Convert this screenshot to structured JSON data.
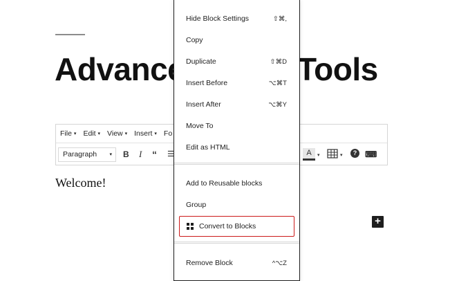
{
  "post": {
    "title_left": "Advance",
    "title_right": "Tools",
    "paragraph": "Welcome!"
  },
  "classic_editor": {
    "menu": [
      {
        "label": "File",
        "caret": "▾"
      },
      {
        "label": "Edit",
        "caret": "▾"
      },
      {
        "label": "View",
        "caret": "▾"
      },
      {
        "label": "Insert",
        "caret": "▾"
      },
      {
        "label": "Fo",
        "caret": ""
      }
    ],
    "format_select": "Paragraph",
    "toolbar": {
      "bold": "B",
      "italic": "I",
      "quote": "“",
      "list": "☰",
      "text_color": "A",
      "help": "?",
      "keyboard": "⌨"
    }
  },
  "block_menu": {
    "items": [
      {
        "label": "Hide Block Settings",
        "shortcut": "⇧⌘,"
      },
      {
        "label": "Copy",
        "shortcut": ""
      },
      {
        "label": "Duplicate",
        "shortcut": "⇧⌘D"
      },
      {
        "label": "Insert Before",
        "shortcut": "⌥⌘T"
      },
      {
        "label": "Insert After",
        "shortcut": "⌥⌘Y"
      },
      {
        "label": "Move To",
        "shortcut": ""
      },
      {
        "label": "Edit as HTML",
        "shortcut": ""
      }
    ],
    "group_items": [
      {
        "label": "Add to Reusable blocks"
      },
      {
        "label": "Group"
      }
    ],
    "convert": {
      "label": "Convert to Blocks",
      "icon": "blocks-grid-icon"
    },
    "remove": {
      "label": "Remove Block",
      "shortcut": "^⌥Z"
    }
  },
  "add_block": {
    "label": "+"
  },
  "colors": {
    "highlight_border": "#cc1818",
    "text": "#1e1e1e"
  }
}
